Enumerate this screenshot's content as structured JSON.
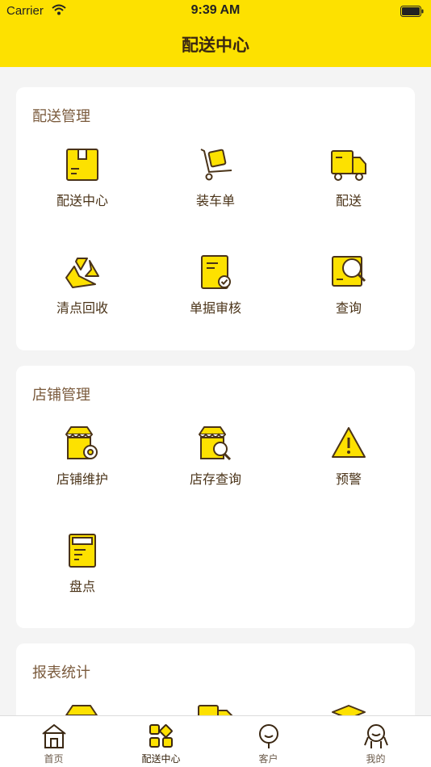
{
  "status": {
    "carrier": "Carrier",
    "time": "9:39 AM"
  },
  "nav": {
    "title": "配送中心"
  },
  "sections": [
    {
      "title": "配送管理",
      "items": [
        {
          "label": "配送中心",
          "icon": "box-icon"
        },
        {
          "label": "装车单",
          "icon": "hand-truck-icon"
        },
        {
          "label": "配送",
          "icon": "truck-icon"
        },
        {
          "label": "清点回收",
          "icon": "recycle-icon"
        },
        {
          "label": "单据审核",
          "icon": "document-check-icon"
        },
        {
          "label": "查询",
          "icon": "search-document-icon"
        }
      ]
    },
    {
      "title": "店铺管理",
      "items": [
        {
          "label": "店铺维护",
          "icon": "store-gear-icon"
        },
        {
          "label": "店存查询",
          "icon": "store-search-icon"
        },
        {
          "label": "预警",
          "icon": "warning-icon"
        },
        {
          "label": "盘点",
          "icon": "calculator-icon"
        }
      ]
    },
    {
      "title": "报表统计",
      "items": []
    }
  ],
  "tabbar": [
    {
      "label": "首页",
      "icon": "home-icon"
    },
    {
      "label": "配送中心",
      "icon": "apps-icon",
      "active": true
    },
    {
      "label": "客户",
      "icon": "customer-icon"
    },
    {
      "label": "我的",
      "icon": "profile-icon"
    }
  ],
  "colors": {
    "brand": "#fde100",
    "ink": "#4a3318",
    "background": "#f4f4f4"
  }
}
